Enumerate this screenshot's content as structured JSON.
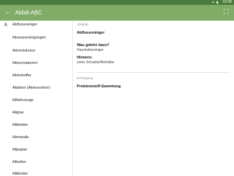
{
  "status": {
    "time": "10:06"
  },
  "app": {
    "title": "Abfall-ABC"
  },
  "sidebar": {
    "letter": "A",
    "items": [
      "Abflussreiniger",
      "Abraussreinigungen",
      "Adventskranz",
      "Akkumulatoren",
      "Aktenkoffer",
      "Altakten (Aktenordner)",
      "Altfahrzeuge",
      "Altglas",
      "Altkleider",
      "Altmetalle",
      "Altpapier",
      "Altreifen",
      "Altkleider"
    ]
  },
  "detail": {
    "section1_label": "Abfallart",
    "item_name": "Abflussreiniger",
    "where_label": "Was gehört dazu?",
    "where_value": "Haushaltsreiniger",
    "hint_label": "Hinweis:",
    "hint_value": "siehe Schadstoffbehälter",
    "section2_label": "Entsorgung",
    "disposal": "Problemstoff-Sammlung"
  }
}
